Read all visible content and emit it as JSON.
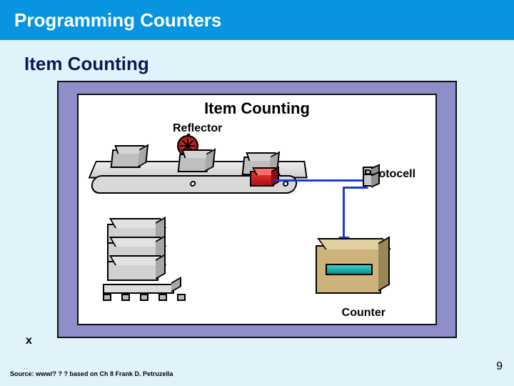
{
  "slide": {
    "title": "Programming Counters",
    "subtitle": "Item Counting",
    "page_number": "9",
    "source_note": "Source: www/? ? ?  based on Ch 8 Frank D. Petruzella",
    "x_mark": "x"
  },
  "figure": {
    "title": "Item Counting",
    "labels": {
      "reflector": "Reflector",
      "photocell": "Photocell",
      "counter": "Counter"
    }
  }
}
